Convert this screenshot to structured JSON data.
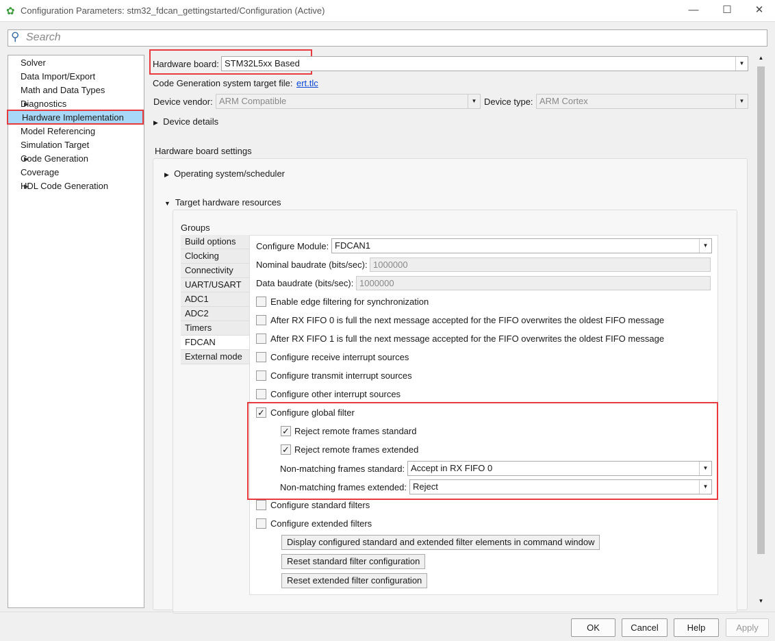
{
  "window": {
    "title": "Configuration Parameters: stm32_fdcan_gettingstarted/Configuration (Active)"
  },
  "search": {
    "placeholder": "Search"
  },
  "tree": [
    {
      "label": "Solver"
    },
    {
      "label": "Data Import/Export"
    },
    {
      "label": "Math and Data Types"
    },
    {
      "label": "Diagnostics",
      "expandable": true
    },
    {
      "label": "Hardware Implementation",
      "selected": true
    },
    {
      "label": "Model Referencing"
    },
    {
      "label": "Simulation Target"
    },
    {
      "label": "Code Generation",
      "expandable": true
    },
    {
      "label": "Coverage"
    },
    {
      "label": "HDL Code Generation",
      "expandable": true
    }
  ],
  "main": {
    "hardware_board_label": "Hardware board:",
    "hardware_board": "STM32L5xx Based",
    "target_file_label": "Code Generation system target file:",
    "target_file": "ert.tlc",
    "vendor_label": "Device vendor:",
    "vendor": "ARM Compatible",
    "type_label": "Device type:",
    "type": "ARM Cortex",
    "device_details": "Device details",
    "board_settings": "Hardware board settings",
    "os_scheduler": "Operating system/scheduler",
    "target_resources": "Target hardware resources",
    "groups_label": "Groups",
    "groups": [
      "Build options",
      "Clocking",
      "Connectivity",
      "UART/USART",
      "ADC1",
      "ADC2",
      "Timers",
      "FDCAN",
      "External mode"
    ],
    "active_group": "FDCAN",
    "module_label": "Configure Module:",
    "module": "FDCAN1",
    "nominal_label": "Nominal baudrate (bits/sec):",
    "nominal": "1000000",
    "data_label": "Data baudrate (bits/sec):",
    "data_baud": "1000000",
    "checks": [
      {
        "label": "Enable edge filtering for synchronization",
        "checked": false
      },
      {
        "label": "After RX FIFO 0 is full the next message accepted for the FIFO overwrites the oldest FIFO message",
        "checked": false
      },
      {
        "label": "After RX FIFO 1 is full the next message accepted for the FIFO overwrites the oldest FIFO message",
        "checked": false
      },
      {
        "label": "Configure receive interrupt sources",
        "checked": false
      },
      {
        "label": "Configure transmit interrupt sources",
        "checked": false
      },
      {
        "label": "Configure other interrupt sources",
        "checked": false
      },
      {
        "label": "Configure global filter",
        "checked": true
      }
    ],
    "reject_std": {
      "label": "Reject remote frames standard",
      "checked": true
    },
    "reject_ext": {
      "label": "Reject remote frames extended",
      "checked": true
    },
    "nm_std_label": "Non-matching frames standard:",
    "nm_std": "Accept in RX FIFO 0",
    "nm_ext_label": "Non-matching frames extended:",
    "nm_ext": "Reject",
    "std_filters": {
      "label": "Configure standard filters",
      "checked": false
    },
    "ext_filters": {
      "label": "Configure extended filters",
      "checked": false
    },
    "btn_display": "Display configured standard and extended filter elements in command window",
    "btn_reset_std": "Reset standard filter configuration",
    "btn_reset_ext": "Reset extended filter configuration"
  },
  "footer": {
    "ok": "OK",
    "cancel": "Cancel",
    "help": "Help",
    "apply": "Apply"
  }
}
